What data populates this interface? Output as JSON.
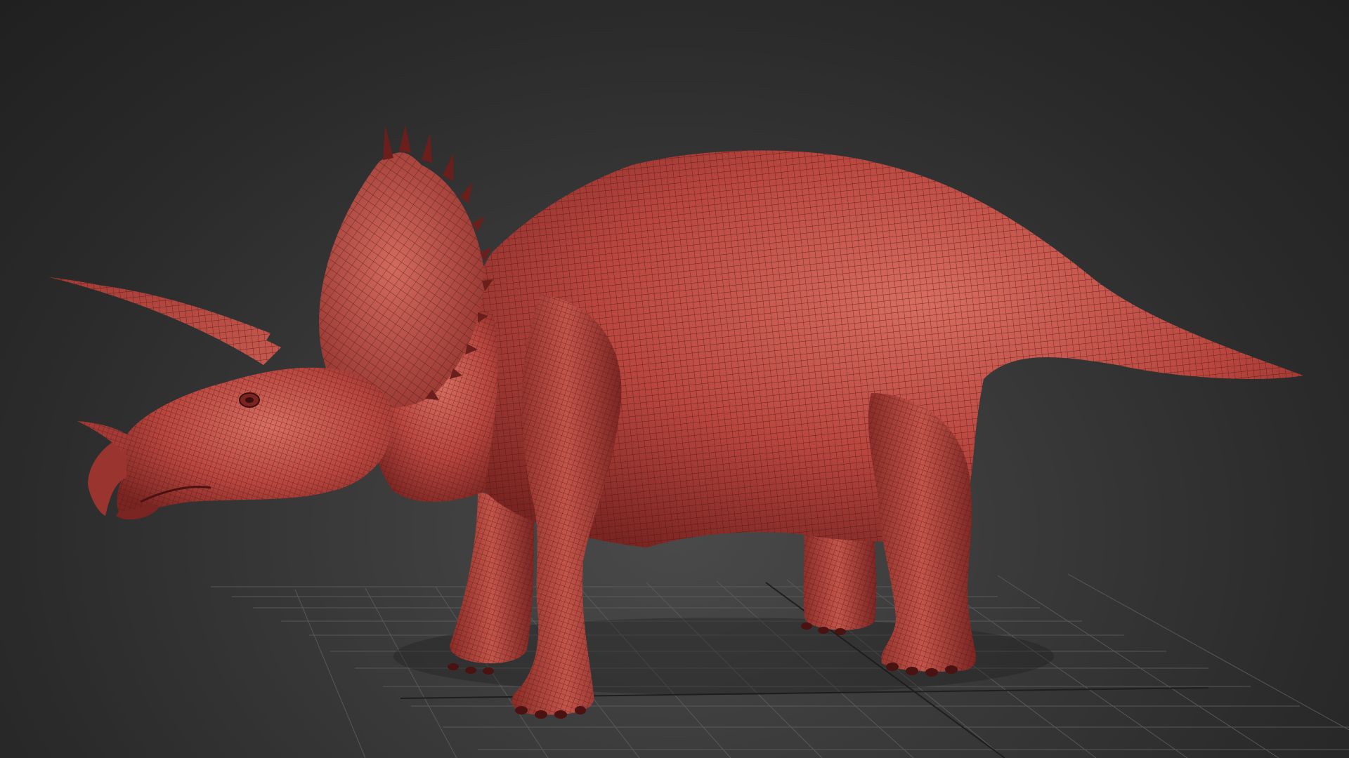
{
  "viewport": {
    "background": "#333333",
    "grid_color": "#5e5e5e",
    "grid_axis_color": "#1e1e1e"
  },
  "model": {
    "subject": "triceratops",
    "display_mode": "wireframe-over-shaded",
    "shade_color": "#b8463f",
    "shade_light": "#d3685d",
    "shade_dark": "#6e201d",
    "wire_color": "#4a1210"
  }
}
